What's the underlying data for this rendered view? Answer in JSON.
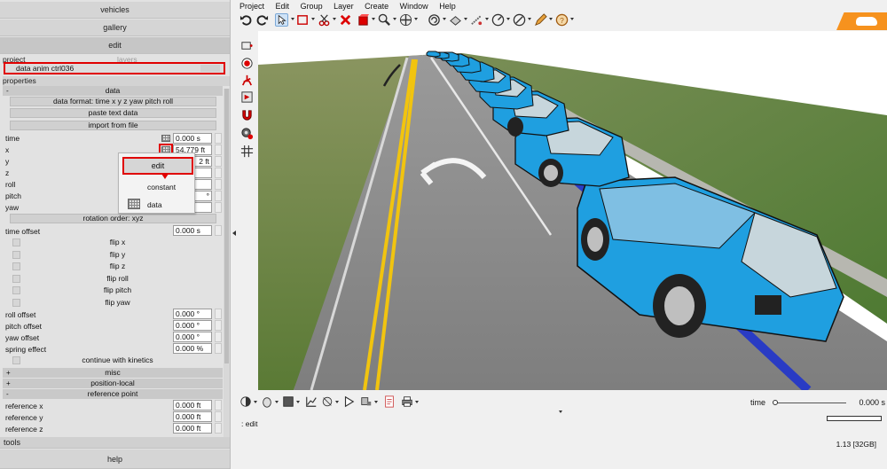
{
  "left_panel": {
    "accordion": {
      "vehicles": "vehicles",
      "gallery": "gallery",
      "edit": "edit",
      "tools": "tools",
      "help": "help"
    },
    "project_label": "project",
    "layers_label": "layers",
    "project_value": "data anim ctrl036",
    "properties_label": "properties",
    "data_header": "data",
    "data_format": "data format: time x y z yaw pitch roll",
    "paste_text": "paste text data",
    "import_file": "import from file",
    "fields": {
      "time": {
        "label": "time",
        "value": "0.000 s"
      },
      "x": {
        "label": "x",
        "value": "54.779 ft"
      },
      "y": {
        "label": "y",
        "value": "2 ft"
      },
      "z": {
        "label": "z",
        "value": ""
      },
      "roll": {
        "label": "roll",
        "value": ""
      },
      "pitch": {
        "label": "pitch",
        "value": "°"
      },
      "yaw": {
        "label": "yaw",
        "value": ""
      }
    },
    "rotation_order": "rotation order: xyz",
    "time_offset": {
      "label": "time offset",
      "value": "0.000 s"
    },
    "flips": [
      "flip x",
      "flip y",
      "flip z",
      "flip roll",
      "flip pitch",
      "flip yaw"
    ],
    "offsets": [
      {
        "label": "roll offset",
        "value": "0.000 °"
      },
      {
        "label": "pitch offset",
        "value": "0.000 °"
      },
      {
        "label": "yaw offset",
        "value": "0.000 °"
      },
      {
        "label": "spring effect",
        "value": "0.000 %"
      }
    ],
    "continue_kinetics": "continue with kinetics",
    "misc": "misc",
    "position_local": "position-local",
    "reference_point": "reference point",
    "refs": [
      {
        "label": "reference x",
        "value": "0.000 ft"
      },
      {
        "label": "reference y",
        "value": "0.000 ft"
      },
      {
        "label": "reference z",
        "value": "0.000 ft"
      }
    ],
    "popup": {
      "edit": "edit",
      "constant": "constant",
      "data": "data"
    }
  },
  "menu": [
    "Project",
    "Edit",
    "Group",
    "Layer",
    "Create",
    "Window",
    "Help"
  ],
  "bottom": {
    "time_label": "time",
    "time_value": "0.000 s",
    "status": ": edit",
    "version": "1.13 [32GB]"
  },
  "colors": {
    "accent_red": "#e00000",
    "vehicle_blue": "#1f9fe0",
    "logo_orange": "#f6921e"
  }
}
